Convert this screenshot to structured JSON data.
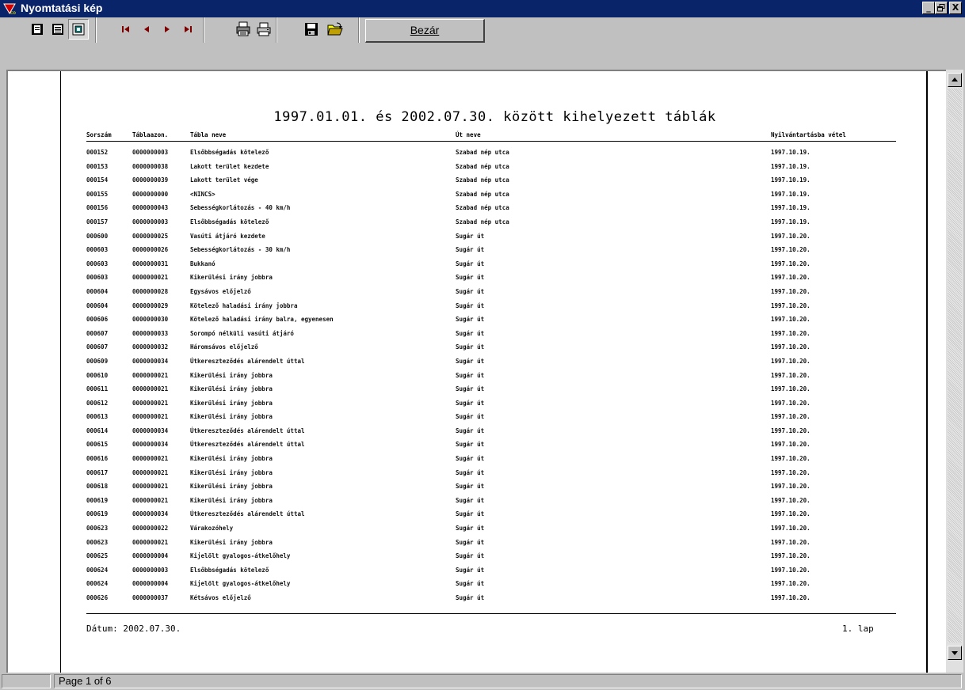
{
  "window": {
    "title": "Nyomtatási kép",
    "title_bar_color": "#0a246a",
    "icon": "report-icon",
    "controls": {
      "minimize": "_",
      "maximize": "▫",
      "close": "X"
    }
  },
  "toolbar": {
    "buttons": [
      {
        "name": "single-page-icon"
      },
      {
        "name": "two-page-icon"
      },
      {
        "name": "zoom-fit-icon",
        "pressed": true
      },
      {
        "name": "first-page-icon"
      },
      {
        "name": "prev-page-icon"
      },
      {
        "name": "next-page-icon"
      },
      {
        "name": "last-page-icon"
      },
      {
        "name": "print-setup-icon"
      },
      {
        "name": "print-icon"
      },
      {
        "name": "save-icon"
      },
      {
        "name": "open-icon"
      }
    ],
    "close_label": "Bezár"
  },
  "report": {
    "title": "1997.01.01. és 2002.07.30. között kihelyezett táblák",
    "headers": {
      "sorszam": "Sorszám",
      "tablaazon": "Táblaazon.",
      "tabla_neve": "Tábla neve",
      "ut_neve": "Út neve",
      "nyilvantartasba_vetel": "Nyilvántartásba vétel"
    },
    "rows": [
      [
        "000152",
        "0000000003",
        "Elsőbbségadás kötelező",
        "Szabad nép utca",
        "1997.10.19."
      ],
      [
        "000153",
        "0000000038",
        "Lakott terület kezdete",
        "Szabad nép utca",
        "1997.10.19."
      ],
      [
        "000154",
        "0000000039",
        "Lakott terület vége",
        "Szabad nép utca",
        "1997.10.19."
      ],
      [
        "000155",
        "0000000000",
        "<NINCS>",
        "Szabad nép utca",
        "1997.10.19."
      ],
      [
        "000156",
        "0000000043",
        "Sebességkorlátozás - 40 km/h",
        "Szabad nép utca",
        "1997.10.19."
      ],
      [
        "000157",
        "0000000003",
        "Elsőbbségadás kötelező",
        "Szabad nép utca",
        "1997.10.19."
      ],
      [
        "000600",
        "0000000025",
        "Vasúti átjáró kezdete",
        "Sugár út",
        "1997.10.20."
      ],
      [
        "000603",
        "0000000026",
        "Sebességkorlátozás - 30 km/h",
        "Sugár út",
        "1997.10.20."
      ],
      [
        "000603",
        "0000000031",
        "Bukkanó",
        "Sugár út",
        "1997.10.20."
      ],
      [
        "000603",
        "0000000021",
        "Kikerülési irány jobbra",
        "Sugár út",
        "1997.10.20."
      ],
      [
        "000604",
        "0000000028",
        "Egysávos előjelző",
        "Sugár út",
        "1997.10.20."
      ],
      [
        "000604",
        "0000000029",
        "Kötelező haladási irány jobbra",
        "Sugár út",
        "1997.10.20."
      ],
      [
        "000606",
        "0000000030",
        "Kötelező haladási irány balra, egyenesen",
        "Sugár út",
        "1997.10.20."
      ],
      [
        "000607",
        "0000000033",
        "Sorompó nélküli vasúti átjáró",
        "Sugár út",
        "1997.10.20."
      ],
      [
        "000607",
        "0000000032",
        "Háromsávos előjelző",
        "Sugár út",
        "1997.10.20."
      ],
      [
        "000609",
        "0000000034",
        "Útkereszteződés alárendelt úttal",
        "Sugár út",
        "1997.10.20."
      ],
      [
        "000610",
        "0000000021",
        "Kikerülési irány jobbra",
        "Sugár út",
        "1997.10.20."
      ],
      [
        "000611",
        "0000000021",
        "Kikerülési irány jobbra",
        "Sugár út",
        "1997.10.20."
      ],
      [
        "000612",
        "0000000021",
        "Kikerülési irány jobbra",
        "Sugár út",
        "1997.10.20."
      ],
      [
        "000613",
        "0000000021",
        "Kikerülési irány jobbra",
        "Sugár út",
        "1997.10.20."
      ],
      [
        "000614",
        "0000000034",
        "Útkereszteződés alárendelt úttal",
        "Sugár út",
        "1997.10.20."
      ],
      [
        "000615",
        "0000000034",
        "Útkereszteződés alárendelt úttal",
        "Sugár út",
        "1997.10.20."
      ],
      [
        "000616",
        "0000000021",
        "Kikerülési irány jobbra",
        "Sugár út",
        "1997.10.20."
      ],
      [
        "000617",
        "0000000021",
        "Kikerülési irány jobbra",
        "Sugár út",
        "1997.10.20."
      ],
      [
        "000618",
        "0000000021",
        "Kikerülési irány jobbra",
        "Sugár út",
        "1997.10.20."
      ],
      [
        "000619",
        "0000000021",
        "Kikerülési irány jobbra",
        "Sugár út",
        "1997.10.20."
      ],
      [
        "000619",
        "0000000034",
        "Útkereszteződés alárendelt úttal",
        "Sugár út",
        "1997.10.20."
      ],
      [
        "000623",
        "0000000022",
        "Várakozóhely",
        "Sugár út",
        "1997.10.20."
      ],
      [
        "000623",
        "0000000021",
        "Kikerülési irány jobbra",
        "Sugár út",
        "1997.10.20."
      ],
      [
        "000625",
        "0000000004",
        "Kijelölt gyalogos-átkelőhely",
        "Sugár út",
        "1997.10.20."
      ],
      [
        "000624",
        "0000000003",
        "Elsőbbségadás kötelező",
        "Sugár út",
        "1997.10.20."
      ],
      [
        "000624",
        "0000000004",
        "Kijelölt gyalogos-átkelőhely",
        "Sugár út",
        "1997.10.20."
      ],
      [
        "000626",
        "0000000037",
        "Kétsávos előjelző",
        "Sugár út",
        "1997.10.20."
      ]
    ],
    "footer_date": "Dátum: 2002.07.30.",
    "footer_page": "1. lap"
  },
  "status": {
    "page_info": "Page 1 of 6"
  }
}
